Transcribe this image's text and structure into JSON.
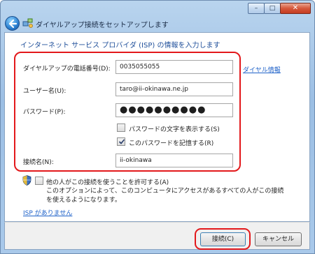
{
  "window": {
    "title": "ダイヤルアップ接続をセットアップします",
    "minimize_glyph": "–",
    "maximize_glyph": "□",
    "close_glyph": "✕"
  },
  "form": {
    "heading": "インターネット サービス プロバイダ (ISP) の情報を入力します",
    "phone_label": "ダイヤルアップの電話番号(D):",
    "phone_value": "0035055055",
    "dialing_rules_link": "ダイヤル情報",
    "username_label": "ユーザー名(U):",
    "username_value": "taro@ii-okinawa.ne.jp",
    "password_label": "パスワード(P):",
    "password_value": "●●●●●●●●●●",
    "show_password_label": "パスワードの文字を表示する(S)",
    "show_password_checked": false,
    "remember_password_label": "このパスワードを記憶する(R)",
    "remember_password_checked": true,
    "connection_name_label": "接続名(N):",
    "connection_name_value": "ii-okinawa",
    "share_label": "他の人がこの接続を使うことを許可する(A)",
    "share_checked": false,
    "share_description": "このオプションによって、このコンピュータにアクセスがあるすべての人がこの接続を使えるようになります。",
    "no_isp_link": "ISP がありません"
  },
  "footer": {
    "connect_label": "接続(C)",
    "cancel_label": "キャンセル"
  },
  "colors": {
    "highlight": "#e3181b",
    "link": "#1f62c9",
    "heading": "#1f4f9a"
  },
  "icons": {
    "back": "back-arrow-icon",
    "title": "network-connection-icon",
    "shield": "uac-shield-icon",
    "check": "checkmark-icon"
  }
}
